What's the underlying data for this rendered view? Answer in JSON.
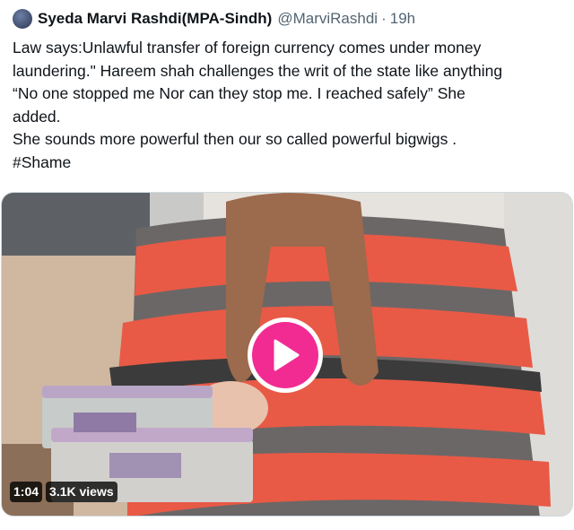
{
  "tweet": {
    "author_name": "Syeda Marvi Rashdi(MPA-Sindh)",
    "author_handle": "@MarviRashdi",
    "separator": "·",
    "time": "19h",
    "lines": [
      "Law says:Unlawful transfer of foreign currency comes under money",
      "laundering.\" Hareem shah challenges the writ of the state like anything",
      "“No one stopped me Nor can they stop me. I reached safely” She",
      "added.",
      "She sounds more powerful then our so  called powerful bigwigs .",
      "#Shame"
    ]
  },
  "video": {
    "duration": "1:04",
    "views": "3.1K views",
    "play_color": "#f22b93"
  },
  "icons": {
    "avatar": "avatar-image",
    "play": "play-icon"
  }
}
